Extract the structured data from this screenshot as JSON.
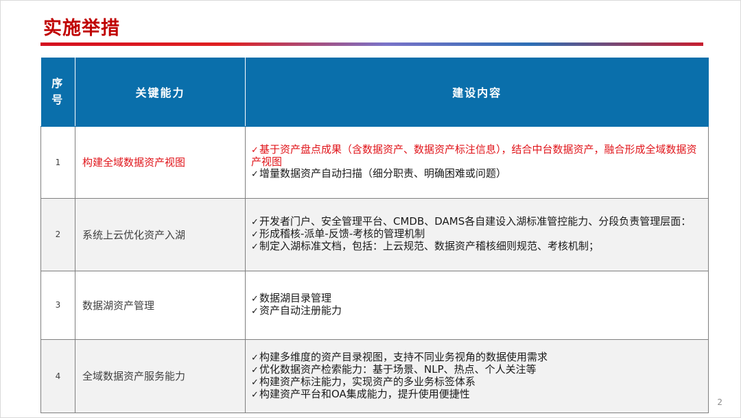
{
  "header": {
    "title": "实施举措"
  },
  "table": {
    "columns": [
      "序\n号",
      "关键能力",
      "建设内容"
    ],
    "col_no_line1": "序",
    "col_no_line2": "号",
    "col_capability": "关键能力",
    "col_content": "建设内容",
    "rows": [
      {
        "no": "1",
        "capability": "构建全域数据资产视图",
        "highlight": true,
        "items": [
          "基于资产盘点成果（含数据资产、数据资产标注信息），结合中台数据资产，融合形成全域数据资产视图",
          "增量数据资产自动扫描（细分职责、明确困难或问题）"
        ]
      },
      {
        "no": "2",
        "capability": "系统上云优化资产入湖",
        "highlight": false,
        "items": [
          "开发者门户、安全管理平台、CMDB、DAMS各自建设入湖标准管控能力、分段负责管理层面：",
          "形成稽核-派单-反馈-考核的管理机制",
          "制定入湖标准文档，包括：上云规范、数据资产稽核细则规范、考核机制；"
        ]
      },
      {
        "no": "3",
        "capability": "数据湖资产管理",
        "highlight": false,
        "items": [
          "数据湖目录管理",
          "资产自动注册能力"
        ]
      },
      {
        "no": "4",
        "capability": "全域数据资产服务能力",
        "highlight": false,
        "items": [
          "构建多维度的资产目录视图，支持不同业务视角的数据使用需求",
          "优化数据资产检索能力：基于场景、NLP、热点、个人关注等",
          "构建资产标注能力，实现资产的多业务标签体系",
          "构建资产平台和OA集成能力，提升使用便捷性"
        ]
      }
    ]
  },
  "check_symbol": "✓",
  "footer": {
    "page_number": "2"
  },
  "colors": {
    "title_red": "#c00000",
    "header_blue": "#0a6fab",
    "highlight_red": "#e0141a"
  }
}
